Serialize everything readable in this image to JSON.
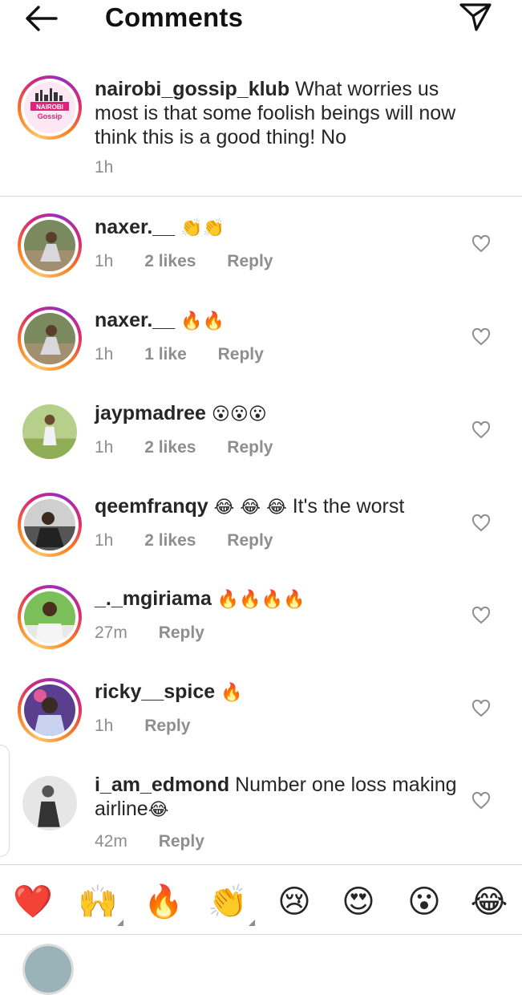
{
  "header": {
    "title": "Comments"
  },
  "caption": {
    "username": "nairobi_gossip_klub",
    "text": "What worries us most is that some foolish beings will now think this is a good thing! No",
    "time": "1h",
    "logo_line1": "NAIROBI",
    "logo_line2": "Gossip"
  },
  "comments": [
    {
      "username": "naxer.__",
      "text": "",
      "emoji": "👏👏",
      "time": "1h",
      "likes": "2 likes",
      "reply": "Reply"
    },
    {
      "username": "naxer.__",
      "text": "",
      "emoji": "🔥🔥",
      "time": "1h",
      "likes": "1 like",
      "reply": "Reply"
    },
    {
      "username": "jaypmadree",
      "text": "",
      "emoji": "😮😮😮",
      "time": "1h",
      "likes": "2 likes",
      "reply": "Reply"
    },
    {
      "username": "qeemfranqy",
      "text": "It's the worst",
      "emoji": "😂 😂 😂",
      "time": "1h",
      "likes": "2 likes",
      "reply": "Reply"
    },
    {
      "username": "_._mgiriama",
      "text": "",
      "emoji": "🔥🔥🔥🔥",
      "time": "27m",
      "likes": "",
      "reply": "Reply"
    },
    {
      "username": "ricky__spice",
      "text": "",
      "emoji": "🔥",
      "time": "1h",
      "likes": "",
      "reply": "Reply"
    },
    {
      "username": "i_am_edmond",
      "text": "Number one loss making airline",
      "emoji": "😂",
      "time": "42m",
      "likes": "",
      "reply": "Reply"
    }
  ],
  "reactions": [
    "❤️",
    "🙌",
    "🔥",
    "👏",
    "😢",
    "😍",
    "😮",
    "😂"
  ],
  "colors": {
    "text": "#262626",
    "muted": "#8e8e8e",
    "divider": "#dbdbdb"
  }
}
